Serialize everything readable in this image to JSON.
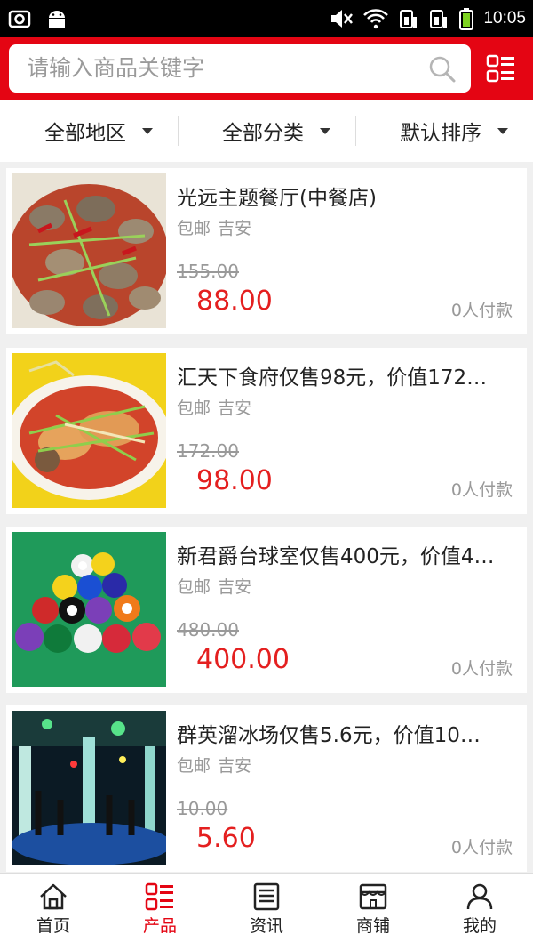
{
  "status_bar": {
    "time": "10:05"
  },
  "search": {
    "placeholder": "请输入商品关键字"
  },
  "filters": [
    {
      "label": "全部地区"
    },
    {
      "label": "全部分类"
    },
    {
      "label": "默认排序"
    }
  ],
  "products": [
    {
      "title": "光远主题餐厅(中餐店)",
      "tags": [
        "包邮",
        "吉安"
      ],
      "old_price": "155.00",
      "price": "88.00",
      "buyers": "0人付款"
    },
    {
      "title": "汇天下食府仅售98元，价值172…",
      "tags": [
        "包邮",
        "吉安"
      ],
      "old_price": "172.00",
      "price": "98.00",
      "buyers": "0人付款"
    },
    {
      "title": "新君爵台球室仅售400元，价值4…",
      "tags": [
        "包邮",
        "吉安"
      ],
      "old_price": "480.00",
      "price": "400.00",
      "buyers": "0人付款"
    },
    {
      "title": "群英溜冰场仅售5.6元，价值10…",
      "tags": [
        "包邮",
        "吉安"
      ],
      "old_price": "10.00",
      "price": "5.60",
      "buyers": "0人付款"
    }
  ],
  "tabs": [
    {
      "label": "首页",
      "icon": "home-icon"
    },
    {
      "label": "产品",
      "icon": "list-icon"
    },
    {
      "label": "资讯",
      "icon": "news-icon"
    },
    {
      "label": "商铺",
      "icon": "store-icon"
    },
    {
      "label": "我的",
      "icon": "user-icon"
    }
  ],
  "colors": {
    "brand": "#e40513",
    "price": "#e41f1f",
    "muted": "#999999"
  }
}
